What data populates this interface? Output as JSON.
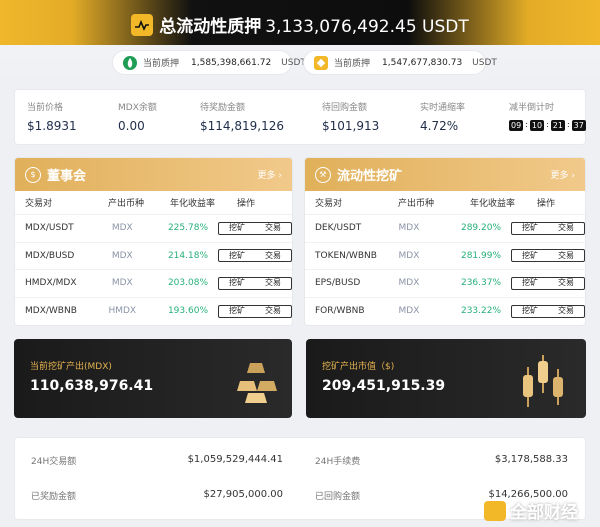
{
  "hero": {
    "title": "总流动性质押",
    "amount": "3,133,076,492.45 USDT",
    "logo_icon": "pulse-chart-icon"
  },
  "pills": [
    {
      "label": "当前质押",
      "value": "1,585,398,661.72",
      "unit": "USDT",
      "icon": "pancake-bunny-icon"
    },
    {
      "label": "当前质押",
      "value": "1,547,677,830.73",
      "unit": "USDT",
      "icon": "bnb-cube-icon"
    }
  ],
  "stats": [
    {
      "label": "当前价格",
      "value": "$1.8931"
    },
    {
      "label": "MDX余额",
      "value": "0.00"
    },
    {
      "label": "待奖励金额",
      "value": "$114,819,126"
    },
    {
      "label": "待回购金额",
      "value": "$101,913"
    },
    {
      "label": "实时通缩率",
      "value": "4.72%"
    },
    {
      "label": "减半倒计时",
      "timer": [
        "09",
        "10",
        "21",
        "37"
      ]
    }
  ],
  "board": {
    "title": "董事会",
    "more": "更多",
    "headers": [
      "交易对",
      "产出币种",
      "年化收益率",
      "操作"
    ],
    "rows": [
      {
        "pair": "MDX/USDT",
        "token": "MDX",
        "apy": "225.78%"
      },
      {
        "pair": "MDX/BUSD",
        "token": "MDX",
        "apy": "214.18%"
      },
      {
        "pair": "HMDX/MDX",
        "token": "MDX",
        "apy": "203.08%"
      },
      {
        "pair": "MDX/WBNB",
        "token": "HMDX",
        "apy": "193.60%"
      }
    ]
  },
  "mining": {
    "title": "流动性挖矿",
    "more": "更多",
    "headers": [
      "交易对",
      "产出币种",
      "年化收益率",
      "操作"
    ],
    "rows": [
      {
        "pair": "DEK/USDT",
        "token": "MDX",
        "apy": "289.20%"
      },
      {
        "pair": "TOKEN/WBNB",
        "token": "MDX",
        "apy": "281.99%"
      },
      {
        "pair": "EPS/BUSD",
        "token": "MDX",
        "apy": "236.37%"
      },
      {
        "pair": "FOR/WBNB",
        "token": "MDX",
        "apy": "233.22%"
      }
    ]
  },
  "actions": {
    "mine": "挖矿",
    "trade": "交易"
  },
  "cards": [
    {
      "label": "当前挖矿产出(MDX)",
      "value": "110,638,976.41",
      "icon": "gold-bars-icon"
    },
    {
      "label": "挖矿产出市值（$)",
      "value": "209,451,915.39",
      "icon": "candlestick-icon"
    }
  ],
  "bottom": [
    {
      "label": "24H交易额",
      "value": "$1,059,529,444.41"
    },
    {
      "label": "24H手续费",
      "value": "$3,178,588.33"
    },
    {
      "label": "已奖励金额",
      "value": "$27,905,000.00"
    },
    {
      "label": "已回购金额",
      "value": "$14,266,500.00"
    }
  ],
  "watermark": "全部财经",
  "colors": {
    "accent_gold": "#e0b05a",
    "apy_green": "#27b07a",
    "hero_dark": "#111111"
  }
}
